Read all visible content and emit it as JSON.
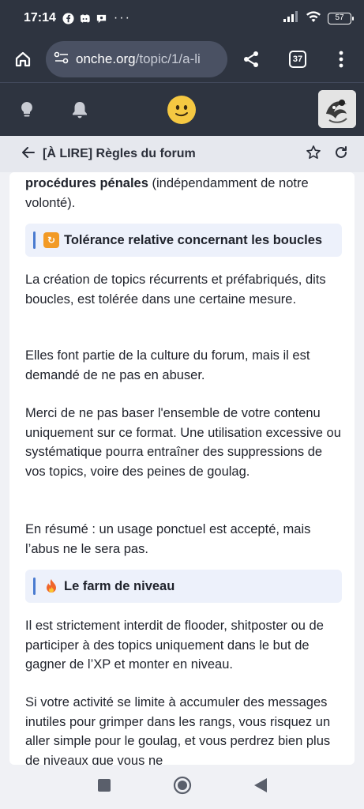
{
  "status": {
    "time": "17:14",
    "battery": "57"
  },
  "browser": {
    "url_domain": "onche.org",
    "url_path": "/topic/1/a-li",
    "tab_count": "37"
  },
  "topic": {
    "title": "[À LIRE] Règles du forum"
  },
  "content": {
    "p_intro_bold": "procédures pénales",
    "p_intro_rest": " (indépendamment de notre volonté).",
    "heading1": "Tolérance relative concernant les boucles",
    "p1": "La création de topics récurrents et préfabriqués, dits boucles, est tolérée dans une certaine mesure.",
    "p2": "Elles font partie de la culture du forum, mais il est demandé de ne pas en abuser.",
    "p3": "Merci de ne pas baser l'ensemble de votre contenu uniquement sur ce format. Une utilisation excessive ou systématique pourra entraîner des suppressions de vos topics, voire des peines de goulag.",
    "p4": "En résumé : un usage ponctuel est accepté, mais l’abus ne le sera pas.",
    "heading2": "Le farm de niveau",
    "p5": "Il est strictement interdit de flooder, shitposter ou de participer à des topics uniquement dans le but de gagner de l’XP et monter en niveau.",
    "p6": "Si votre activité se limite à accumuler des messages inutiles pour grimper dans les rangs, vous risquez un aller simple pour le goulag, et vous perdrez bien plus de niveaux que vous ne"
  },
  "colors": {
    "chrome_bg": "#2e3440",
    "heading_bg": "#edf1fb",
    "heading_accent": "#4a7bd0",
    "logo": "#f5c842"
  },
  "icons": {
    "status": [
      "facebook-icon",
      "discord-icon",
      "chat-icon",
      "signal-icon",
      "wifi-icon",
      "battery-icon"
    ],
    "browser": [
      "home-icon",
      "site-settings-icon",
      "share-icon",
      "tabs-icon",
      "more-icon"
    ],
    "header": [
      "lightbulb-icon",
      "bell-icon",
      "smiley-logo",
      "user-avatar"
    ],
    "topic": [
      "back-arrow-icon",
      "star-icon",
      "refresh-icon"
    ],
    "nav": [
      "recents-icon",
      "home-circle-icon",
      "back-triangle-icon"
    ]
  }
}
